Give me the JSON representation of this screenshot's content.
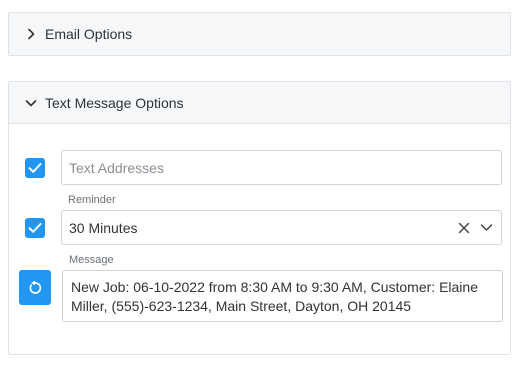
{
  "email_options": {
    "title": "Email Options",
    "icon": "chevron-right-icon"
  },
  "text_options": {
    "title": "Text Message Options",
    "icon": "chevron-down-icon",
    "text_addresses": {
      "checked": true,
      "placeholder": "Text Addresses"
    },
    "reminder": {
      "checked": true,
      "label": "Reminder",
      "value": "30 Minutes"
    },
    "message": {
      "label": "Message",
      "value": "New Job: 06-10-2022 from 8:30 AM to 9:30 AM, Customer: Elaine Miller, (555)-623-1234, Main Street, Dayton, OH 20145"
    }
  },
  "colors": {
    "accent": "#2196f3",
    "header_bg": "#f6f7f8",
    "border": "#dfe2e6"
  }
}
